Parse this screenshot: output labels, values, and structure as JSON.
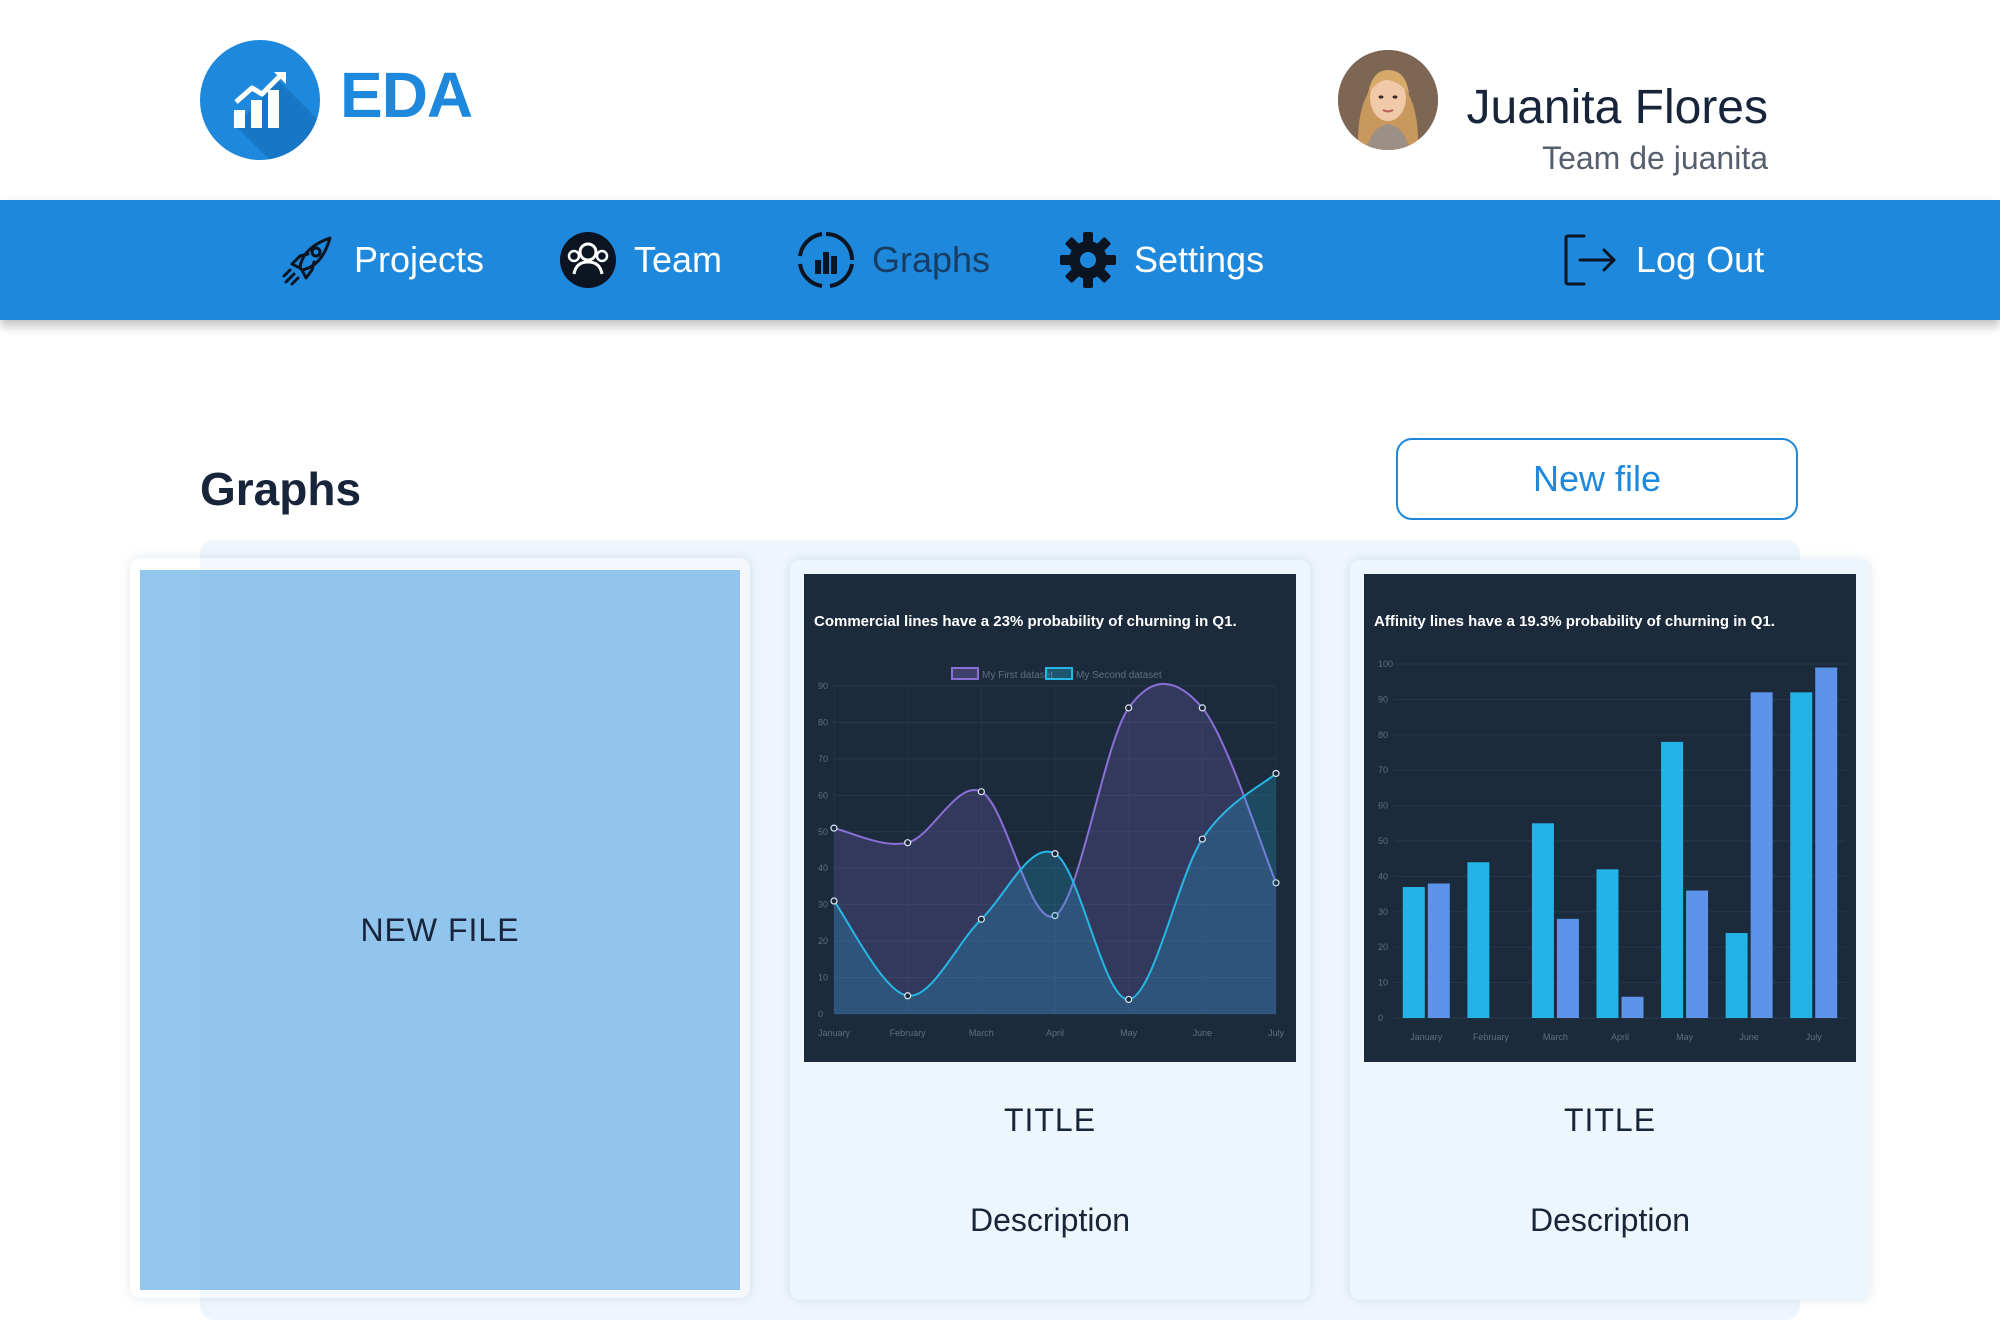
{
  "brand": {
    "name": "EDA",
    "accent": "#1e88dc"
  },
  "user": {
    "name": "Juanita Flores",
    "team": "Team de juanita"
  },
  "nav": {
    "items": [
      {
        "label": "Projects",
        "icon": "rocket-icon"
      },
      {
        "label": "Team",
        "icon": "team-icon"
      },
      {
        "label": "Graphs",
        "icon": "graphs-icon",
        "active": true
      },
      {
        "label": "Settings",
        "icon": "gear-icon"
      }
    ],
    "logout_label": "Log Out"
  },
  "page": {
    "title": "Graphs",
    "new_file_button": "New file"
  },
  "new_file_card": {
    "label": "NEW FILE"
  },
  "cards": [
    {
      "title": "TITLE",
      "description": "Description"
    },
    {
      "title": "TITLE",
      "description": "Description"
    }
  ],
  "chart_data": [
    {
      "type": "line",
      "title": "Commercial lines have a 23% probability of churning in Q1.",
      "categories": [
        "January",
        "February",
        "March",
        "April",
        "May",
        "June",
        "July"
      ],
      "series": [
        {
          "name": "My First dataset",
          "values": [
            51,
            47,
            61,
            27,
            84,
            84,
            36
          ],
          "color": "#8a6fd6"
        },
        {
          "name": "My Second dataset",
          "values": [
            31,
            5,
            26,
            44,
            4,
            48,
            66
          ],
          "color": "#25b8e6"
        }
      ],
      "yticks": [
        0,
        10,
        20,
        30,
        40,
        50,
        60,
        70,
        80,
        90
      ],
      "ylim": [
        0,
        90
      ],
      "legend": "top",
      "background": "#1b2b3c"
    },
    {
      "type": "bar",
      "title": "Affinity lines have a 19.3% probability of churning in Q1.",
      "categories": [
        "January",
        "February",
        "March",
        "April",
        "May",
        "June",
        "July"
      ],
      "series": [
        {
          "values": [
            37,
            44,
            55,
            42,
            78,
            24,
            92
          ],
          "color": "#22b4e6"
        },
        {
          "values": [
            38,
            0,
            28,
            6,
            36,
            92,
            99
          ],
          "color": "#5d93e8"
        }
      ],
      "yticks": [
        0,
        10,
        20,
        30,
        40,
        50,
        60,
        70,
        80,
        90,
        100
      ],
      "ylim": [
        0,
        100
      ],
      "background": "#1b2b3c"
    }
  ]
}
